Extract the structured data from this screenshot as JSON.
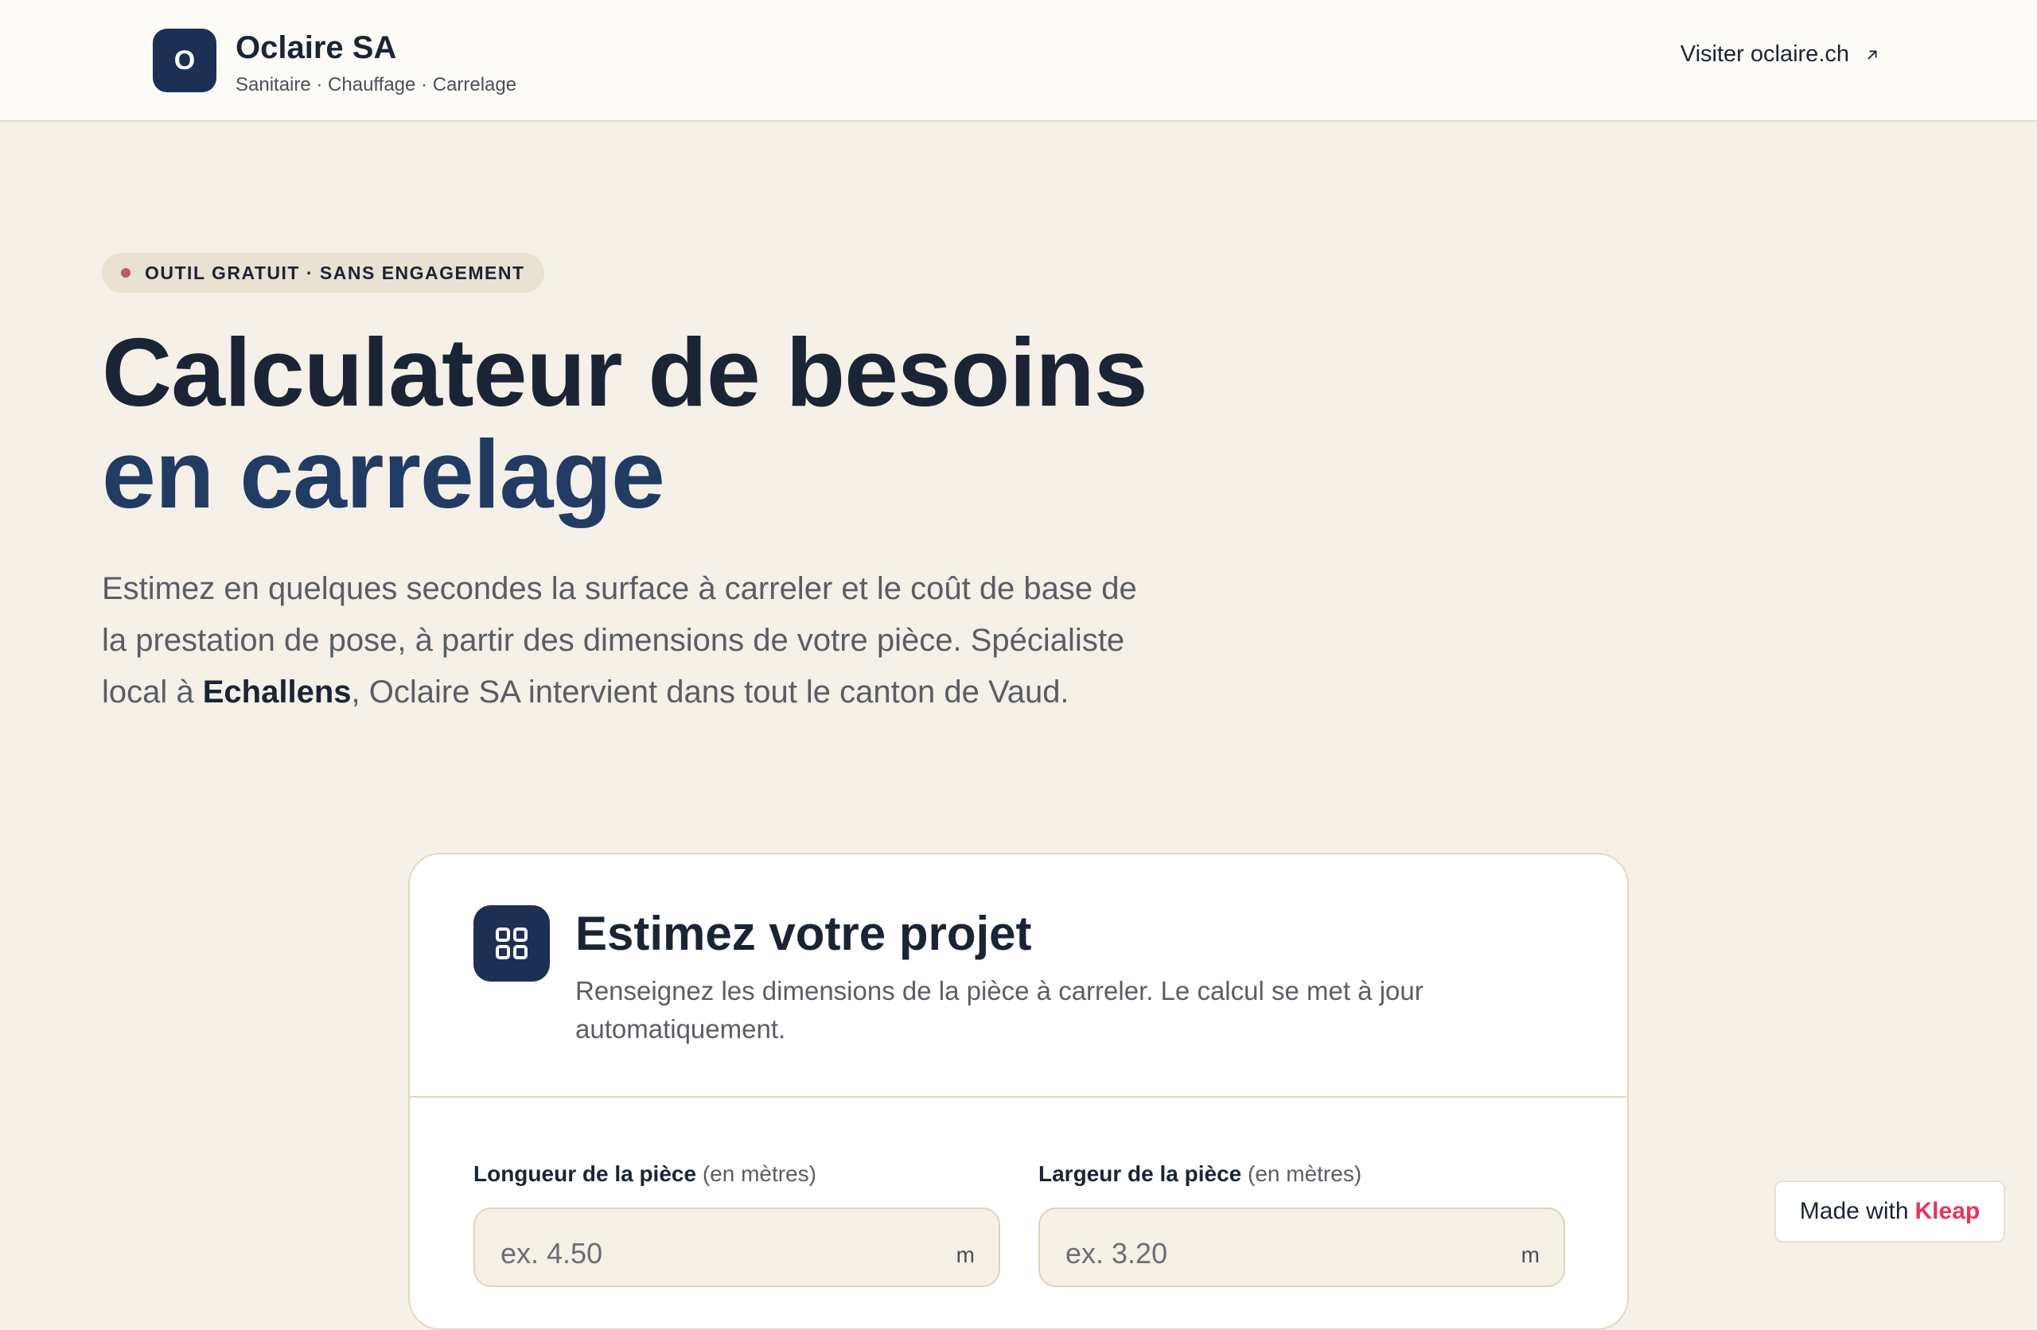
{
  "header": {
    "logo_letter": "O",
    "brand_name": "Oclaire SA",
    "brand_tagline": "Sanitaire · Chauffage · Carrelage",
    "visit_link": "Visiter oclaire.ch"
  },
  "hero": {
    "badge": "OUTIL GRATUIT · SANS ENGAGEMENT",
    "title_line1": "Calculateur de besoins",
    "title_line2": "en carrelage",
    "lead_part1": "Estimez en quelques secondes la surface à carreler et le coût de base de la prestation de pose, à partir des dimensions de votre pièce. Spécialiste local à ",
    "lead_bold": "Echallens",
    "lead_part2": ", Oclaire SA intervient dans tout le canton de Vaud."
  },
  "card": {
    "title": "Estimez votre projet",
    "subtitle": "Renseignez les dimensions de la pièce à carreler. Le calcul se met à jour automatiquement.",
    "fields": [
      {
        "label": "Longueur de la pièce",
        "unit_note": "(en mètres)",
        "placeholder": "ex. 4.50",
        "value": "",
        "suffix": "m"
      },
      {
        "label": "Largeur de la pièce",
        "unit_note": "(en mètres)",
        "placeholder": "ex. 3.20",
        "value": "",
        "suffix": "m"
      }
    ]
  },
  "badge": {
    "made_with": "Made with",
    "brand": "Kleap",
    "brand_color": "#e8345a"
  },
  "colors": {
    "background": "#f5f1e8",
    "navy": "#1c3054",
    "accent_dot": "#c0566a"
  },
  "icons": {
    "external_link": "arrow-up-right-icon",
    "card_icon": "grid-icon"
  }
}
